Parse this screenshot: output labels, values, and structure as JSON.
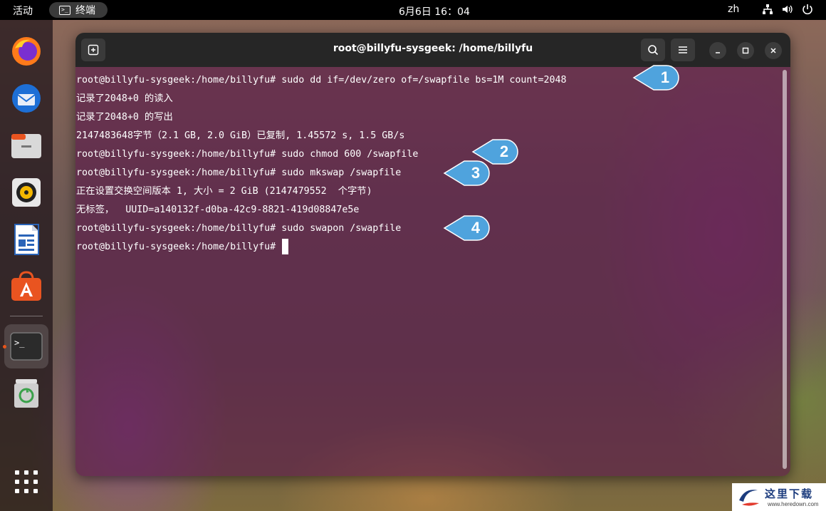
{
  "topbar": {
    "activities": "活动",
    "app_name": "终端",
    "clock": "6月6日  16：04",
    "input_lang": "zh"
  },
  "dock": {
    "items": [
      "firefox-icon",
      "thunderbird-icon",
      "files-icon",
      "rhythmbox-icon",
      "writer-icon",
      "software-icon",
      "terminal-icon",
      "trash-icon"
    ],
    "active": "terminal-icon"
  },
  "window": {
    "title": "root@billyfu-sysgeek: /home/billyfu"
  },
  "terminal": {
    "lines": [
      "root@billyfu-sysgeek:/home/billyfu# sudo dd if=/dev/zero of=/swapfile bs=1M count=2048",
      "记录了2048+0 的读入",
      "记录了2048+0 的写出",
      "2147483648字节（2.1 GB, 2.0 GiB）已复制, 1.45572 s, 1.5 GB/s",
      "root@billyfu-sysgeek:/home/billyfu# sudo chmod 600 /swapfile",
      "root@billyfu-sysgeek:/home/billyfu# sudo mkswap /swapfile",
      "正在设置交换空间版本 1, 大小 = 2 GiB (2147479552  个字节)",
      "无标签，  UUID=a140132f-d0ba-42c9-8821-419d08847e5e",
      "root@billyfu-sysgeek:/home/billyfu# sudo swapon /swapfile",
      "root@billyfu-sysgeek:/home/billyfu# "
    ]
  },
  "callouts": [
    "1",
    "2",
    "3",
    "4"
  ],
  "colors": {
    "callout_fill": "#4fa3dd",
    "terminal_bg": "#581648",
    "headerbar": "#262626",
    "accent": "#e9541a"
  },
  "watermark": {
    "title": "这里下载",
    "url": "www.heredown.com"
  }
}
